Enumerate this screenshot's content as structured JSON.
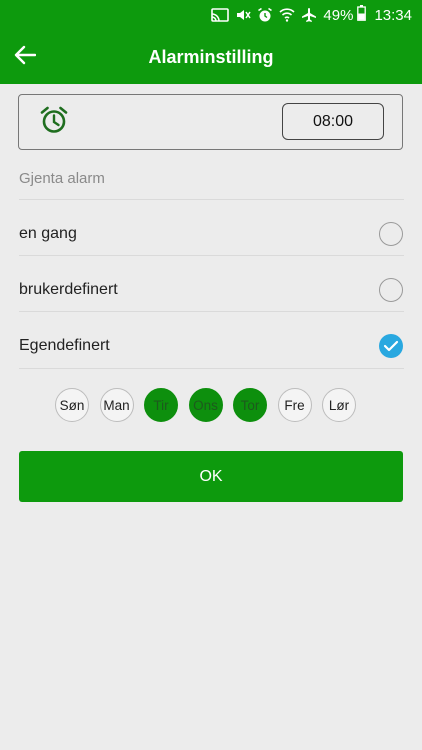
{
  "status_bar": {
    "battery": "49%",
    "time": "13:34",
    "icons": [
      "cast-icon",
      "mute-icon",
      "alarm-icon",
      "wifi-icon",
      "airplane-icon",
      "battery-icon"
    ]
  },
  "header": {
    "back_icon": "arrow-left-icon",
    "title": "Alarminstilling"
  },
  "alarm": {
    "icon": "alarm-clock-icon",
    "time": "08:00"
  },
  "repeat": {
    "label": "Gjenta alarm",
    "options": [
      {
        "label": "en gang",
        "selected": false
      },
      {
        "label": "brukerdefinert",
        "selected": false
      },
      {
        "label": "Egendefinert",
        "selected": true
      }
    ]
  },
  "days": [
    {
      "label": "Søn",
      "active": false
    },
    {
      "label": "Man",
      "active": false
    },
    {
      "label": "Tir",
      "active": true
    },
    {
      "label": "Ons",
      "active": true
    },
    {
      "label": "Tor",
      "active": true
    },
    {
      "label": "Fre",
      "active": false
    },
    {
      "label": "Lør",
      "active": false
    }
  ],
  "ok_label": "OK",
  "colors": {
    "primary": "#0d9a0d",
    "day_active": "#0d8f0d",
    "check": "#29a8e0",
    "background": "#ececec"
  }
}
